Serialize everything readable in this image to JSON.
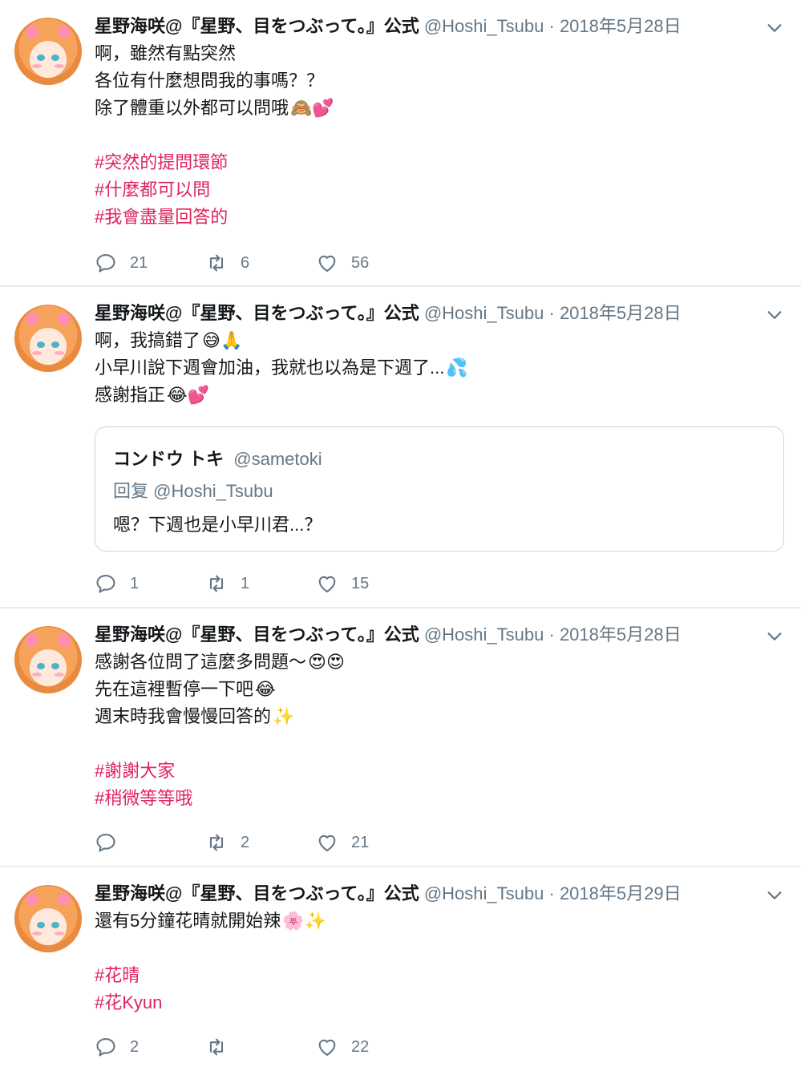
{
  "tweets": [
    {
      "name": "星野海咲@『星野、目をつぶって。』公式",
      "handle": "@Hoshi_Tsubu",
      "dot": "·",
      "date": "2018年5月28日",
      "lines": [
        {
          "text": "啊，雖然有點突然",
          "emoji": ""
        },
        {
          "text": "各位有什麼想問我的事嗎？？",
          "emoji": ""
        },
        {
          "text": "除了體重以外都可以問哦",
          "emoji": "🙈💕"
        },
        {
          "text": "",
          "emoji": ""
        },
        {
          "tag": "#突然的提問環節"
        },
        {
          "tag": "#什麼都可以問"
        },
        {
          "tag": "#我會盡量回答的"
        }
      ],
      "replies": "21",
      "retweets": "6",
      "likes": "56"
    },
    {
      "name": "星野海咲@『星野、目をつぶって。』公式",
      "handle": "@Hoshi_Tsubu",
      "dot": "·",
      "date": "2018年5月28日",
      "lines": [
        {
          "text": "啊，我搞錯了",
          "emoji": "😅🙏"
        },
        {
          "text": "小早川說下週會加油，我就也以為是下週了...",
          "emoji": "💦"
        },
        {
          "text": "感謝指正",
          "emoji": "😂💕"
        }
      ],
      "quote": {
        "name": "コンドウ トキ",
        "handle": "@sametoki",
        "reply_to": "回复 @Hoshi_Tsubu",
        "text": "嗯？下週也是小早川君...？"
      },
      "replies": "1",
      "retweets": "1",
      "likes": "15"
    },
    {
      "name": "星野海咲@『星野、目をつぶって。』公式",
      "handle": "@Hoshi_Tsubu",
      "dot": "·",
      "date": "2018年5月28日",
      "lines": [
        {
          "text": "感謝各位問了這麼多問題～",
          "emoji": "😍😍"
        },
        {
          "text": "先在這裡暫停一下吧",
          "emoji": "😂"
        },
        {
          "text": "週末時我會慢慢回答的",
          "emoji": "✨"
        },
        {
          "text": "",
          "emoji": ""
        },
        {
          "tag": "#謝謝大家"
        },
        {
          "tag": "#稍微等等哦"
        }
      ],
      "replies": "",
      "retweets": "2",
      "likes": "21"
    },
    {
      "name": "星野海咲@『星野、目をつぶって。』公式",
      "handle": "@Hoshi_Tsubu",
      "dot": "·",
      "date": "2018年5月29日",
      "lines": [
        {
          "text": "還有5分鐘花晴就開始辣",
          "emoji": "🌸✨"
        },
        {
          "text": "",
          "emoji": ""
        },
        {
          "tag": "#花晴"
        },
        {
          "tag": "#花Kyun"
        }
      ],
      "replies": "2",
      "retweets": "",
      "likes": "22"
    }
  ],
  "colors": {
    "hashtag": "#e0245e",
    "muted": "#657786",
    "text": "#14171a",
    "divider": "#e6ecf0"
  },
  "icons": [
    "reply-icon",
    "retweet-icon",
    "like-icon",
    "chevron-down-icon",
    "avatar"
  ]
}
